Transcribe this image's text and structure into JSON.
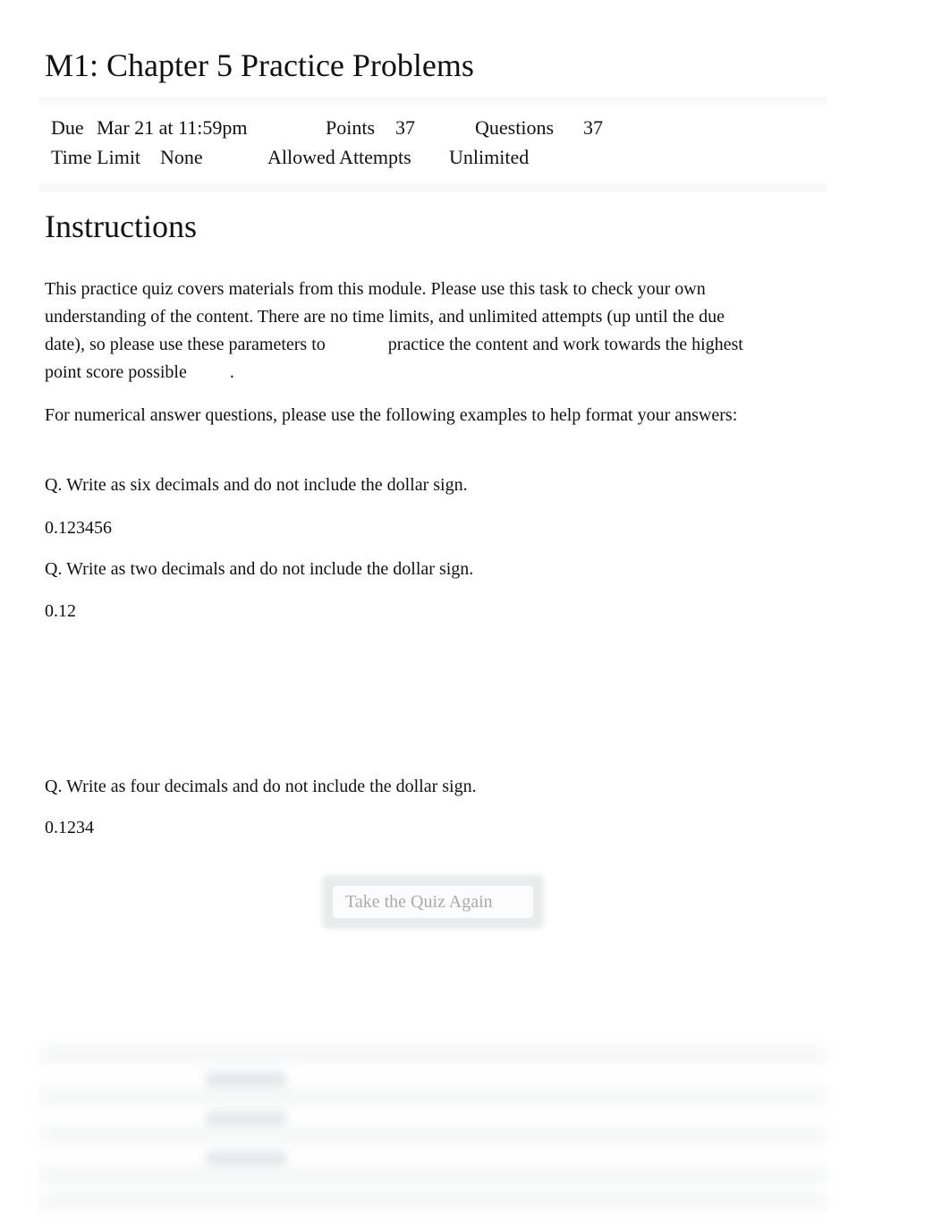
{
  "page": {
    "title": "M1: Chapter 5 Practice Problems"
  },
  "details": {
    "due_label": "Due",
    "due_value": "Mar 21 at 11:59pm",
    "points_label": "Points",
    "points_value": "37",
    "questions_label": "Questions",
    "questions_value": "37",
    "time_limit_label": "Time Limit",
    "time_limit_value": "None",
    "attempts_label": "Allowed Attempts",
    "attempts_value": "Unlimited"
  },
  "instructions": {
    "heading": "Instructions",
    "intro_part1": "This practice quiz covers materials from this module. Please use this task to check your own understanding of the content. There are no time limits, and unlimited attempts (up until the due date), so please use these parameters to",
    "intro_part2": "practice the content and work towards the highest point score possible",
    "intro_end": ".",
    "format_note": "For numerical answer questions, please use the following examples to help format your answers:",
    "examples": [
      {
        "question": "Q. Write as six decimals and do not include the dollar sign.",
        "answer": "0.123456"
      },
      {
        "question": "Q. Write as two decimals and do not include the dollar sign.",
        "answer": "0.12"
      },
      {
        "question": "Q. Write as four decimals and do not include the dollar sign.",
        "answer": "0.1234"
      }
    ]
  },
  "actions": {
    "retake_label": "Take the Quiz Again"
  }
}
